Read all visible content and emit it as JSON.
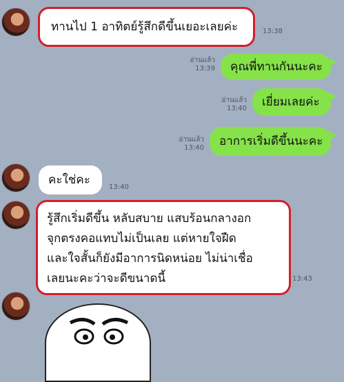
{
  "chat": {
    "messages": [
      {
        "side": "left",
        "text": "ทานไป 1 อาทิตย์รู้สึกดีขึ้นเยอะเลยค่ะ",
        "time": "13:38",
        "highlighted": true
      },
      {
        "side": "right",
        "text": "คุณพี่ทานกันนะคะ",
        "read": "อ่านแล้ว",
        "time": "13:39"
      },
      {
        "side": "right",
        "text": "เยี่ยมเลยค่ะ",
        "read": "อ่านแล้ว",
        "time": "13:40"
      },
      {
        "side": "right",
        "text": "อาการเริ่มดีขึ้นนะคะ",
        "read": "อ่านแล้ว",
        "time": "13:40"
      },
      {
        "side": "left",
        "text": "คะใช่คะ",
        "time": "13:40"
      },
      {
        "side": "left",
        "lines": [
          "รู้สึกเริ่มดีขึ้น หลับสบาย แสบร้อนกลางอก",
          "จุกตรงคอแทบไม่เป็นเลย แต่หายใจฝืด",
          "และใจสั้นก็ยังมีอาการนิดหน่อย ไม่น่าเชื่อ",
          "เลยนะคะว่าจะดีขนาดนี้"
        ],
        "time": "13:43",
        "highlighted": true
      }
    ]
  },
  "colors": {
    "background": "#a3b0c2",
    "sent_bubble": "#85e249",
    "received_bubble": "#ffffff",
    "highlight_border": "#d21f2a"
  },
  "icons": {
    "avatar": "user-avatar",
    "sticker": "cartoon-face-sticker"
  }
}
